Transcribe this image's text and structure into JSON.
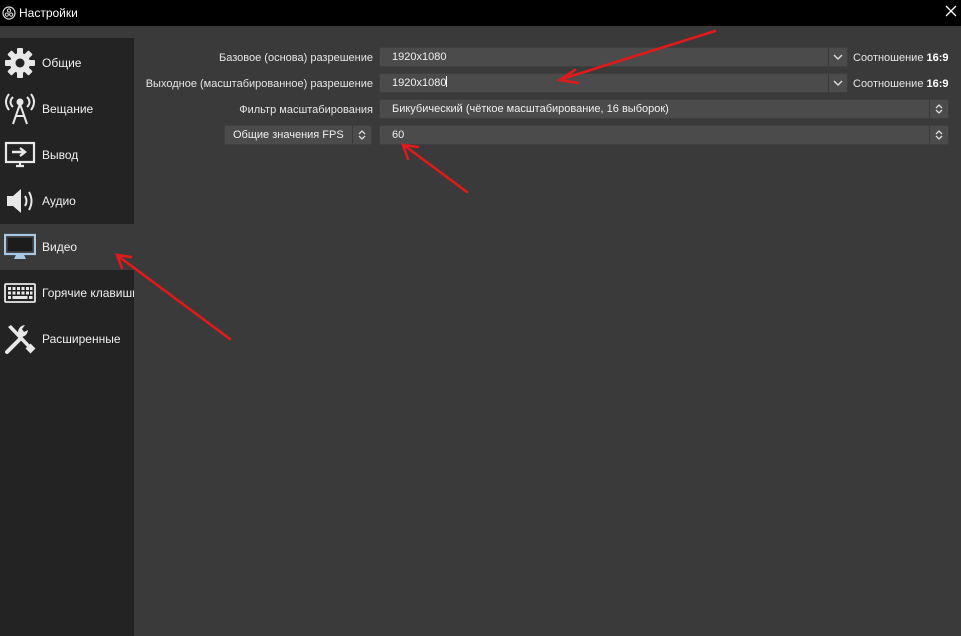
{
  "window": {
    "title": "Настройки",
    "app_icon": "obs-logo-icon",
    "close_icon": "close-icon"
  },
  "sidebar": {
    "items": [
      {
        "label": "Общие",
        "icon": "gear-icon"
      },
      {
        "label": "Вещание",
        "icon": "broadcast-antenna-icon"
      },
      {
        "label": "Вывод",
        "icon": "output-monitor-icon"
      },
      {
        "label": "Аудио",
        "icon": "speaker-icon"
      },
      {
        "label": "Видео",
        "icon": "monitor-icon",
        "active": true
      },
      {
        "label": "Горячие клавиши",
        "icon": "keyboard-icon"
      },
      {
        "label": "Расширенные",
        "icon": "tools-icon"
      }
    ]
  },
  "video": {
    "base_resolution": {
      "label": "Базовое (основа) разрешение",
      "value": "1920x1080",
      "ratio_prefix": "Соотношение",
      "ratio_value": "16:9"
    },
    "output_resolution": {
      "label": "Выходное (масштабированное) разрешение",
      "value": "1920x1080",
      "ratio_prefix": "Соотношение",
      "ratio_value": "16:9"
    },
    "downscale_filter": {
      "label": "Фильтр масштабирования",
      "value": "Бикубический (чёткое масштабирование, 16 выборок)"
    },
    "fps": {
      "type_label": "Общие значения FPS",
      "value": "60"
    }
  },
  "colors": {
    "titlebar": "#000000",
    "sidebar": "#232323",
    "content": "#3a3a3a",
    "field": "#4b4b4b",
    "annotation_arrow": "#e0191b",
    "active_icon": "#a9c8e6"
  }
}
